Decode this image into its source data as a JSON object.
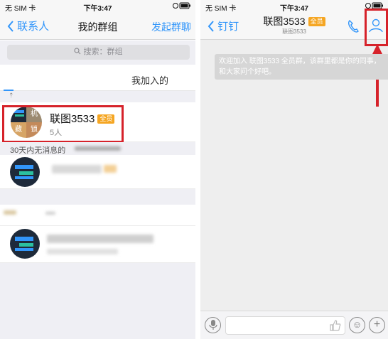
{
  "left": {
    "status": {
      "carrier": "无 SIM 卡",
      "time": "下午3:47"
    },
    "nav": {
      "back": "联系人",
      "title": "我的群组",
      "action": "发起群聊"
    },
    "search": {
      "placeholder": "搜索：群组"
    },
    "tabs": {
      "joined": "我加入的"
    },
    "groups": [
      {
        "name": "联图3533",
        "badge": "全员",
        "members": "5人",
        "avatar_chars": [
          "机",
          "",
          "藏",
          "锁"
        ]
      }
    ],
    "inactive_label": "30天内无消息的",
    "colors": {
      "accent": "#3296fa",
      "badge": "#f5a623",
      "highlight": "#d6222a"
    }
  },
  "right": {
    "status": {
      "carrier": "无 SIM 卡",
      "time": "下午3:47"
    },
    "nav": {
      "back": "钉钉",
      "title": "联图3533",
      "badge": "全员",
      "subtitle": "联图3533"
    },
    "system_message": "欢迎加入 联图3533 全员群，该群里都是你的同事，和大家问个好吧。",
    "icons": [
      "phone-icon",
      "group-members-icon",
      "microphone-icon",
      "thumbs-up-icon",
      "emoji-icon",
      "plus-icon"
    ]
  }
}
